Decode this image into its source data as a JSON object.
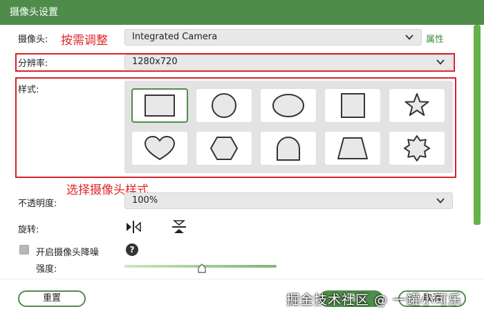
{
  "window": {
    "title": "摄像头设置"
  },
  "camera": {
    "label": "摄像头:",
    "value": "Integrated Camera",
    "properties_link": "属性"
  },
  "annotations": {
    "adjust": "按需调整",
    "choose_style": "选择摄像头样式"
  },
  "resolution": {
    "label": "分辨率:",
    "value": "1280x720"
  },
  "style": {
    "label": "样式:",
    "shapes": [
      {
        "icon": "rectangle-shape-icon",
        "selected": true
      },
      {
        "icon": "circle-shape-icon",
        "selected": false
      },
      {
        "icon": "ellipse-shape-icon",
        "selected": false
      },
      {
        "icon": "square-shape-icon",
        "selected": false
      },
      {
        "icon": "star-shape-icon",
        "selected": false
      },
      {
        "icon": "heart-shape-icon",
        "selected": false
      },
      {
        "icon": "hexagon-shape-icon",
        "selected": false
      },
      {
        "icon": "arch-shape-icon",
        "selected": false
      },
      {
        "icon": "trapezoid-shape-icon",
        "selected": false
      },
      {
        "icon": "badge-shape-icon",
        "selected": false
      }
    ]
  },
  "opacity": {
    "label": "不透明度:",
    "value": "100%"
  },
  "rotate": {
    "label": "旋转:",
    "icons": [
      "flip-horizontal-icon",
      "flip-vertical-icon"
    ]
  },
  "denoise": {
    "label": "开启摄像头降噪",
    "checked": false,
    "icon": "help-icon",
    "help_glyph": "?"
  },
  "strength": {
    "label": "强度:",
    "level": 0.5
  },
  "footer": {
    "reset_label": "重置",
    "ok_label": "确",
    "cancel_label": "取消"
  },
  "watermark": "掘金技术社区 @ 一罐小可乐",
  "colors": {
    "accent": "#4e8c4a",
    "annotation": "#e0262a",
    "scrollbar": "#67b04e"
  }
}
